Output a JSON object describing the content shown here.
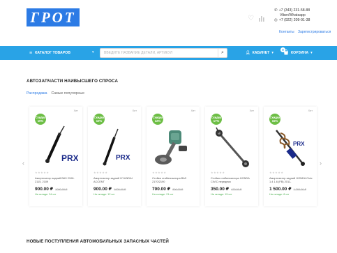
{
  "header": {
    "logo_text": "ГРОТ",
    "phone": "+7 (343) 231-58-88",
    "messengers": "Viber/Whatsapp",
    "phone2": "+7 (922) 209-91-38",
    "contacts_link": "Контакты",
    "register_link": "Зарегистрироваться",
    "compare_icon": "bar-chart-icon",
    "favorites_icon": "heart-icon"
  },
  "nav": {
    "catalog_label": "КАТАЛОГ ТОВАРОВ",
    "search_placeholder": "ВВЕДИТЕ НАЗВАНИЕ ДЕТАЛИ, АРТИКУЛ",
    "cabinet_label": "КАБИНЕТ",
    "cart_label": "КОРЗИНА",
    "cart_count": "0",
    "bar_color": "#29a3e6"
  },
  "section_popular": {
    "title": "АВТОЗАПЧАСТИ НАИВЫСШЕГО СПРОСА",
    "tabs": [
      "Распродажа",
      "Самые популярные"
    ]
  },
  "products": [
    {
      "discount": "10%",
      "discount_label": "Скидка",
      "name": "Амортизатор задний ВАЗ 2108-2115, 2109",
      "price": "900.00 ₽",
      "old_price": "1000.00 ₽",
      "stock": "На складе: 34 шт",
      "image": "shock-absorber-prx",
      "badge_text": "PRX",
      "rating": "★★★★★",
      "tag": "Хит"
    },
    {
      "discount": "10%",
      "discount_label": "Скидка",
      "name": "Амортизатор задний HYUNDAI ACCENT",
      "price": "900.00 ₽",
      "old_price": "1000.00 ₽",
      "stock": "На складе: 12 шт",
      "image": "shock-absorber-prx",
      "badge_text": "PRX",
      "rating": "★★★★★",
      "tag": "Хит"
    },
    {
      "discount": "12%",
      "discount_label": "Скидка",
      "name": "Стойка стабилизатора ВАЗ 2170/2190",
      "price": "700.00 ₽",
      "old_price": "800.00 ₽",
      "stock": "На складе: 21 шт",
      "image": "stabilizer-link",
      "badge_text": "",
      "rating": "★★★★★",
      "tag": "Хит"
    },
    {
      "discount": "17%",
      "discount_label": "Скидка",
      "name": "Стойка стабилизатора HONDA CIVIC передняя",
      "price": "350.00 ₽",
      "old_price": "420.00 ₽",
      "stock": "На складе: 15 шт",
      "image": "stabilizer-rod",
      "badge_text": "",
      "rating": "★★★★★",
      "tag": "Хит"
    },
    {
      "discount": "15%",
      "discount_label": "Скидка",
      "name": "Амортизатор задний HONDA Civic 1.4 1.6 (FB) 2011-",
      "price": "1 500.00 ₽",
      "old_price": "1 760.00 ₽",
      "stock": "На складе: 8 шт",
      "image": "shock-absorber-coil",
      "badge_text": "PRX",
      "rating": "★★★★★",
      "tag": "Хит"
    }
  ],
  "section_new": {
    "title": "НОВЫЕ ПОСТУПЛЕНИЯ АВТОМОБИЛЬНЫХ ЗАПАСНЫХ ЧАСТЕЙ"
  }
}
